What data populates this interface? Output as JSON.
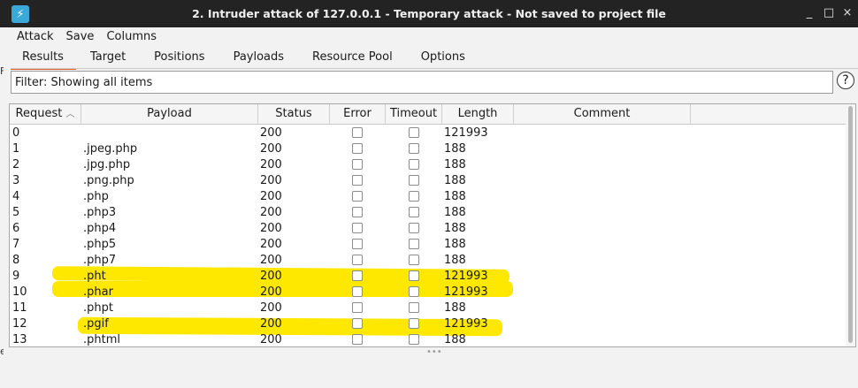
{
  "window": {
    "title": "2. Intruder attack of 127.0.0.1 - Temporary attack - Not saved to project file",
    "app_icon": "burp-lightning-icon",
    "controls": [
      "_",
      "□",
      "×"
    ]
  },
  "menu": [
    "Attack",
    "Save",
    "Columns"
  ],
  "tabs": [
    "Results",
    "Target",
    "Positions",
    "Payloads",
    "Resource Pool",
    "Options"
  ],
  "active_tab": "Results",
  "filter": {
    "label": "Filter: Showing all items",
    "help": "?"
  },
  "columns": [
    "Request",
    "Payload",
    "Status",
    "Error",
    "Timeout",
    "Length",
    "Comment"
  ],
  "sort_indicator": "^",
  "rows": [
    {
      "request": "0",
      "payload": "",
      "status": "200",
      "length": "121993",
      "highlight": false
    },
    {
      "request": "1",
      "payload": ".jpeg.php",
      "status": "200",
      "length": "188",
      "highlight": false
    },
    {
      "request": "2",
      "payload": ".jpg.php",
      "status": "200",
      "length": "188",
      "highlight": false
    },
    {
      "request": "3",
      "payload": ".png.php",
      "status": "200",
      "length": "188",
      "highlight": false
    },
    {
      "request": "4",
      "payload": ".php",
      "status": "200",
      "length": "188",
      "highlight": false
    },
    {
      "request": "5",
      "payload": ".php3",
      "status": "200",
      "length": "188",
      "highlight": false
    },
    {
      "request": "6",
      "payload": ".php4",
      "status": "200",
      "length": "188",
      "highlight": false
    },
    {
      "request": "7",
      "payload": ".php5",
      "status": "200",
      "length": "188",
      "highlight": false
    },
    {
      "request": "8",
      "payload": ".php7",
      "status": "200",
      "length": "188",
      "highlight": false
    },
    {
      "request": "9",
      "payload": ".pht",
      "status": "200",
      "length": "121993",
      "highlight": true
    },
    {
      "request": "10",
      "payload": ".phar",
      "status": "200",
      "length": "121993",
      "highlight": true
    },
    {
      "request": "11",
      "payload": ".phpt",
      "status": "200",
      "length": "188",
      "highlight": false
    },
    {
      "request": "12",
      "payload": ".pgif",
      "status": "200",
      "length": "121993",
      "highlight": true
    },
    {
      "request": "13",
      "payload": ".phtml",
      "status": "200",
      "length": "188",
      "highlight": false
    }
  ],
  "highlight_color": "#ffe800",
  "accent_color": "#e8632c"
}
